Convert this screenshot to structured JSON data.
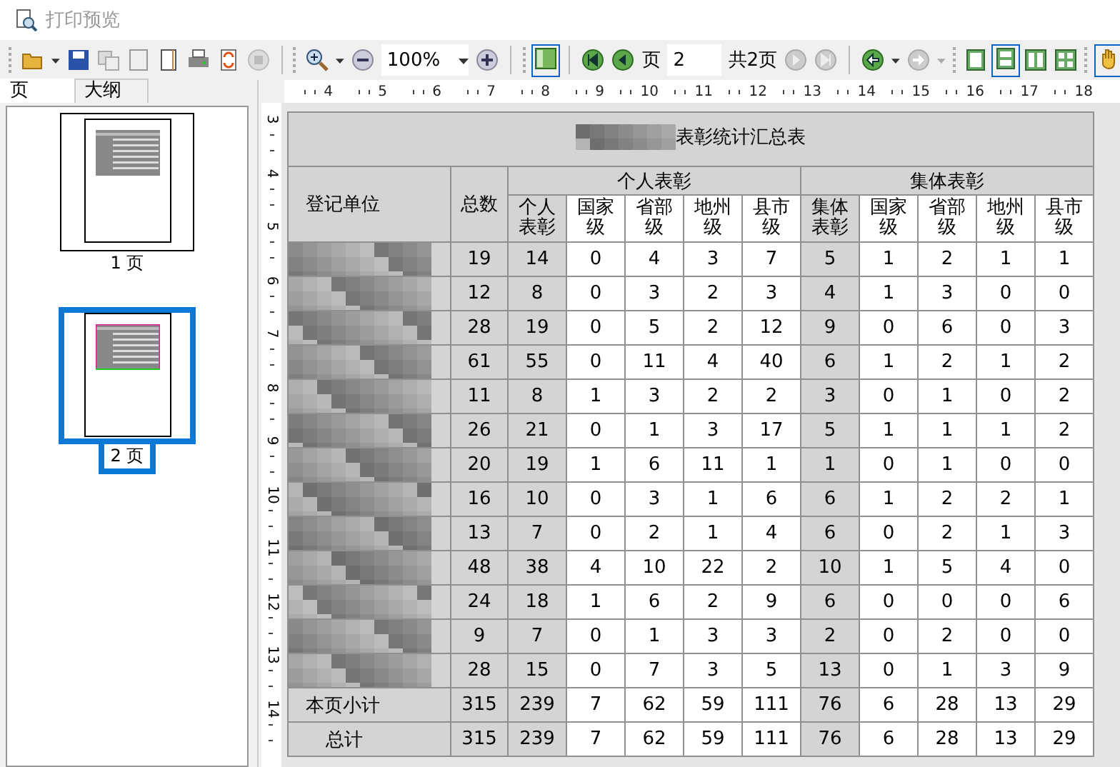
{
  "window": {
    "title": "打印预览"
  },
  "toolbar": {
    "zoom": "100%",
    "page_label": "页",
    "page": "2",
    "page_total": "共2页"
  },
  "horizontal_ruler": [
    "4",
    "5",
    "6",
    "7",
    "8",
    "9",
    "10",
    "11",
    "12",
    "13",
    "14",
    "15",
    "16",
    "17",
    "18"
  ],
  "vertical_ruler": [
    "3",
    "4",
    "5",
    "6",
    "7",
    "8",
    "9",
    "10",
    "11",
    "12",
    "13",
    "14"
  ],
  "sidebar": {
    "tabs": [
      {
        "label": "页",
        "selected": true
      },
      {
        "label": "大纲",
        "selected": false
      }
    ],
    "thumbnails": [
      {
        "label": "1 页",
        "selected": false
      },
      {
        "label": "2 页",
        "selected": true
      }
    ]
  },
  "report": {
    "title": "表彰统计汇总表",
    "unit_header": "登记单位",
    "total_header": "总数",
    "groups": [
      {
        "label": "个人表彰",
        "columns": [
          "个人表彰",
          "国家级",
          "省部级",
          "地州级",
          "县市级"
        ]
      },
      {
        "label": "集体表彰",
        "columns": [
          "集体表彰",
          "国家级",
          "省部级",
          "地州级",
          "县市级"
        ]
      }
    ],
    "rows": [
      [
        "19",
        "14",
        "0",
        "4",
        "3",
        "7",
        "5",
        "1",
        "2",
        "1",
        "1"
      ],
      [
        "12",
        "8",
        "0",
        "3",
        "2",
        "3",
        "4",
        "1",
        "3",
        "0",
        "0"
      ],
      [
        "28",
        "19",
        "0",
        "5",
        "2",
        "12",
        "9",
        "0",
        "6",
        "0",
        "3"
      ],
      [
        "61",
        "55",
        "0",
        "11",
        "4",
        "40",
        "6",
        "1",
        "2",
        "1",
        "2"
      ],
      [
        "11",
        "8",
        "1",
        "3",
        "2",
        "2",
        "3",
        "0",
        "1",
        "0",
        "2"
      ],
      [
        "26",
        "21",
        "0",
        "1",
        "3",
        "17",
        "5",
        "1",
        "1",
        "1",
        "2"
      ],
      [
        "20",
        "19",
        "1",
        "6",
        "11",
        "1",
        "1",
        "0",
        "1",
        "0",
        "0"
      ],
      [
        "16",
        "10",
        "0",
        "3",
        "1",
        "6",
        "6",
        "1",
        "2",
        "2",
        "1"
      ],
      [
        "13",
        "7",
        "0",
        "2",
        "1",
        "4",
        "6",
        "0",
        "2",
        "1",
        "3"
      ],
      [
        "48",
        "38",
        "4",
        "10",
        "22",
        "2",
        "10",
        "1",
        "5",
        "4",
        "0"
      ],
      [
        "24",
        "18",
        "1",
        "6",
        "2",
        "9",
        "6",
        "0",
        "0",
        "0",
        "6"
      ],
      [
        "9",
        "7",
        "0",
        "1",
        "3",
        "3",
        "2",
        "0",
        "2",
        "0",
        "0"
      ],
      [
        "28",
        "15",
        "0",
        "7",
        "3",
        "5",
        "13",
        "0",
        "1",
        "3",
        "9"
      ]
    ],
    "summary": [
      {
        "label": "本页小计",
        "values": [
          "315",
          "239",
          "7",
          "62",
          "59",
          "111",
          "76",
          "6",
          "28",
          "13",
          "29"
        ]
      },
      {
        "label": "总计",
        "values": [
          "315",
          "239",
          "7",
          "62",
          "59",
          "111",
          "76",
          "6",
          "28",
          "13",
          "29"
        ]
      }
    ]
  }
}
